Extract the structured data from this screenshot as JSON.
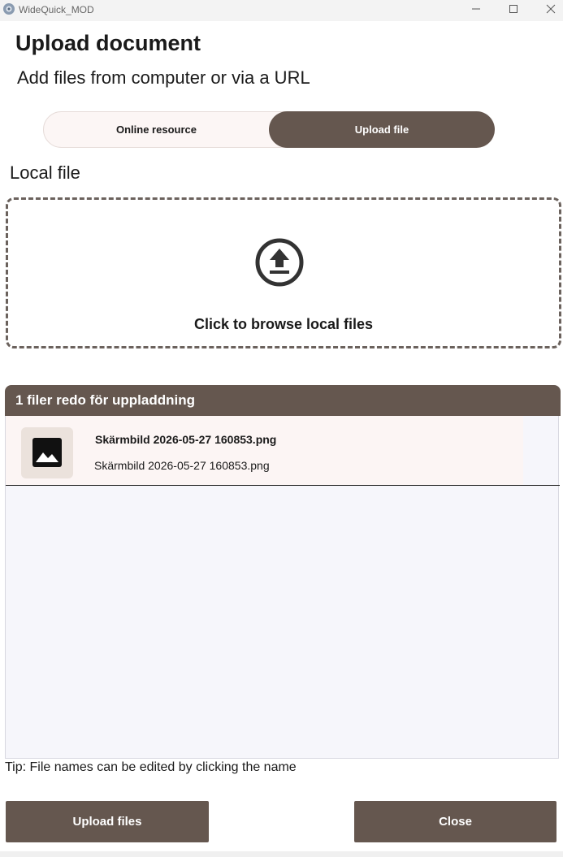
{
  "window": {
    "title": "WideQuick_MOD"
  },
  "header": {
    "title": "Upload document",
    "subtitle": "Add files from computer or via a URL"
  },
  "tabs": [
    {
      "label": "Online resource",
      "selected": false
    },
    {
      "label": "Upload file",
      "selected": true
    }
  ],
  "local_file": {
    "section_label": "Local file",
    "drop_text": "Click to browse local files",
    "icon": "upload-icon"
  },
  "file_list": {
    "header": "1 filer redo för uppladdning",
    "files": [
      {
        "name": "Skärmbild 2026-05-27 160853.png",
        "filename": "Skärmbild 2026-05-27 160853.png",
        "icon": "image-icon"
      }
    ]
  },
  "tip": "Tip: File names can be edited by clicking the name",
  "buttons": {
    "upload": "Upload files",
    "close": "Close"
  },
  "colors": {
    "accent": "#65574f",
    "row_bg": "#fcf5f4",
    "list_bg": "#f6f6fb"
  }
}
